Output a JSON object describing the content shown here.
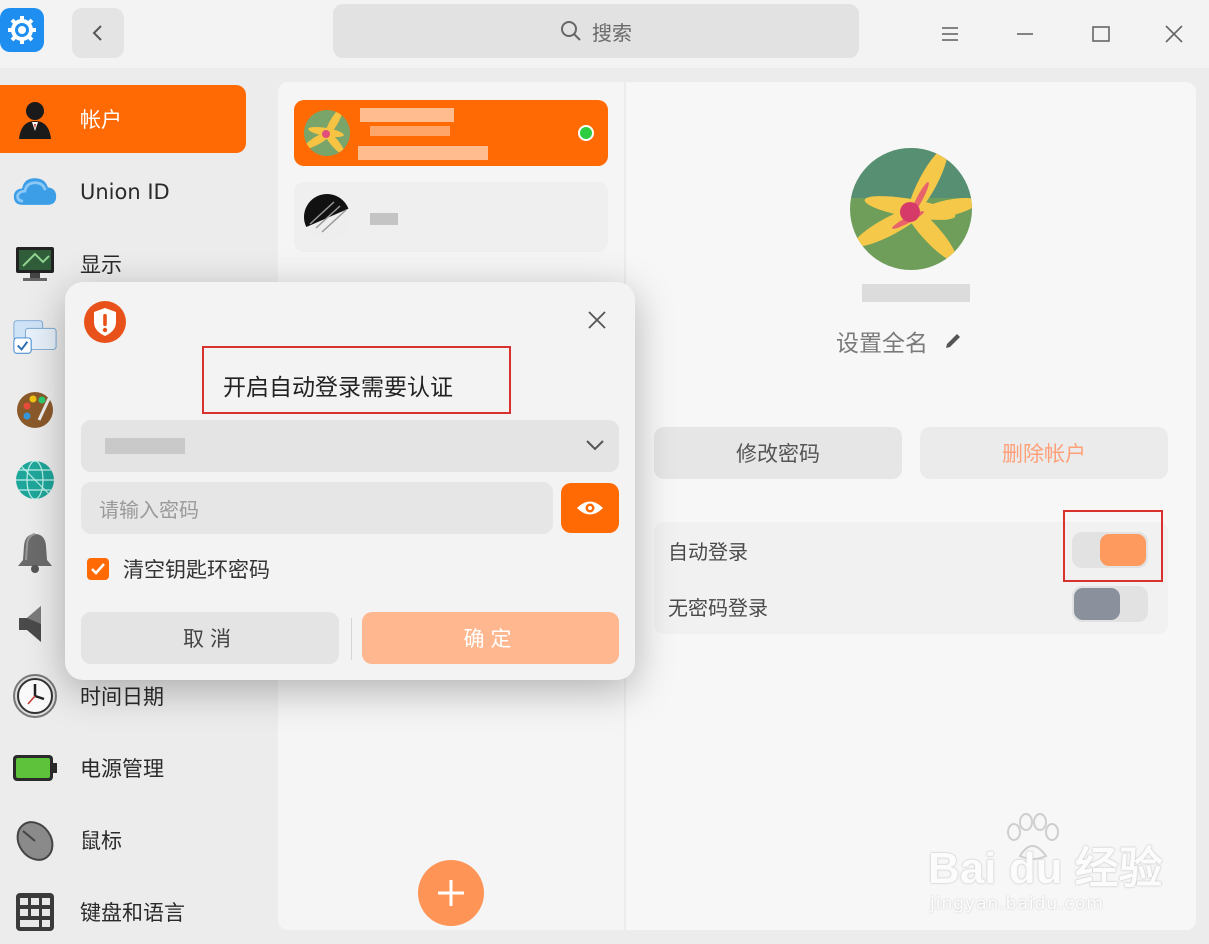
{
  "search": {
    "label": "搜索"
  },
  "sidebar": {
    "items": [
      {
        "label": "帐户",
        "icon": "user-icon",
        "active": true
      },
      {
        "label": "Union ID",
        "icon": "cloud-icon"
      },
      {
        "label": "显示",
        "icon": "monitor-icon"
      },
      {
        "label": "",
        "icon": "default-apps-icon"
      },
      {
        "label": "",
        "icon": "palette-icon"
      },
      {
        "label": "",
        "icon": "network-icon"
      },
      {
        "label": "",
        "icon": "bell-icon"
      },
      {
        "label": "",
        "icon": "speaker-icon"
      },
      {
        "label": "时间日期",
        "icon": "clock-icon"
      },
      {
        "label": "电源管理",
        "icon": "battery-icon"
      },
      {
        "label": "鼠标",
        "icon": "mouse-icon"
      },
      {
        "label": "键盘和语言",
        "icon": "keyboard-icon"
      }
    ]
  },
  "detail": {
    "set_fullname": "设置全名",
    "change_password": "修改密码",
    "delete_account": "删除帐户",
    "auto_login": {
      "label": "自动登录",
      "on": true
    },
    "passwordless_login": {
      "label": "无密码登录",
      "on": false
    }
  },
  "dialog": {
    "title": "开启自动登录需要认证",
    "password_placeholder": "请输入密码",
    "clear_keyring": "清空钥匙环密码",
    "clear_keyring_checked": true,
    "cancel": "取消",
    "confirm": "确定"
  },
  "colors": {
    "accent": "#ff6a05",
    "online": "#2ecc40",
    "annotation": "#d9322e"
  },
  "watermark": {
    "main": "Bai du 经验",
    "sub": "jingyan.baidu.com"
  }
}
